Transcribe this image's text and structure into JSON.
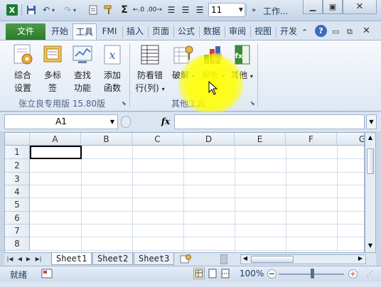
{
  "titlebar": {
    "font_size": "11",
    "title": "工作...",
    "win_min": "▭",
    "win_max": "□",
    "win_close": "✕"
  },
  "tabs": [
    "文件",
    "开始",
    "工具",
    "FMI",
    "插入",
    "页面",
    "公式",
    "数据",
    "审阅",
    "视图",
    "开发"
  ],
  "ribbon": {
    "group1": {
      "buttons": [
        {
          "line1": "综合",
          "line2": "设置"
        },
        {
          "line1": "多标",
          "line2": "签"
        },
        {
          "line1": "查找",
          "line2": "功能"
        },
        {
          "line1": "添加",
          "line2": "函数"
        }
      ],
      "label": "张立良专用版 15.80版"
    },
    "group2": {
      "buttons": [
        {
          "line1": "防看错",
          "line2": "行(列)"
        },
        {
          "line1": "",
          "line2": "破解"
        },
        {
          "line1": "",
          "line2": "模板"
        },
        {
          "line1": "",
          "line2": "其他"
        }
      ],
      "label": "其他工具"
    }
  },
  "formula_bar": {
    "name_box": "A1",
    "fx": "fx",
    "formula": ""
  },
  "grid": {
    "columns": [
      "A",
      "B",
      "C",
      "D",
      "E",
      "F",
      "G"
    ],
    "rows": [
      "1",
      "2",
      "3",
      "4",
      "5",
      "6",
      "7",
      "8"
    ]
  },
  "sheets": {
    "tabs": [
      "Sheet1",
      "Sheet2",
      "Sheet3"
    ],
    "active": 0
  },
  "statusbar": {
    "status": "就绪",
    "zoom": "100%"
  },
  "colors": {
    "file_tab": "#2c7a2a",
    "highlight": "#ffff00"
  }
}
